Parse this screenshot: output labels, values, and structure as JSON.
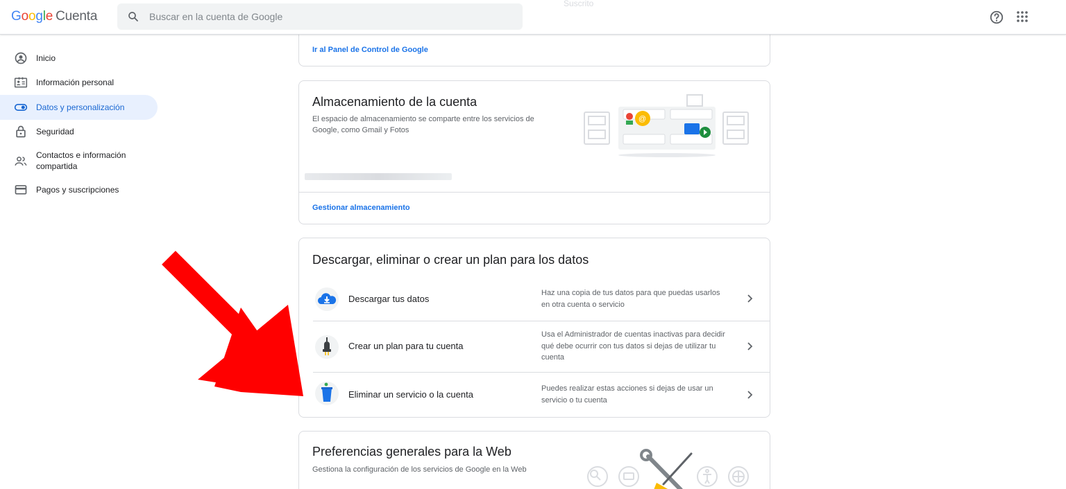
{
  "header": {
    "logo_text": "Google",
    "product": "Cuenta",
    "search_placeholder": "Buscar en la cuenta de Google",
    "ghost_text": "Suscrito",
    "help_icon": "help-icon",
    "apps_icon": "apps-grid-icon"
  },
  "sidebar": {
    "items": [
      {
        "label": "Inicio",
        "icon": "account-circle-icon",
        "active": false
      },
      {
        "label": "Información personal",
        "icon": "id-card-icon",
        "active": false
      },
      {
        "label": "Datos y personalización",
        "icon": "toggle-icon",
        "active": true
      },
      {
        "label": "Seguridad",
        "icon": "lock-icon",
        "active": false
      },
      {
        "label": "Contactos e información compartida",
        "icon": "people-icon",
        "active": false
      },
      {
        "label": "Pagos y suscripciones",
        "icon": "credit-card-icon",
        "active": false
      }
    ]
  },
  "dashboard_card": {
    "link": "Ir al Panel de Control de Google"
  },
  "storage_card": {
    "title": "Almacenamiento de la cuenta",
    "description": "El espacio de almacenamiento se comparte entre los servicios de Google, como Gmail y Fotos",
    "link": "Gestionar almacenamiento"
  },
  "data_card": {
    "title": "Descargar, eliminar o crear un plan para los datos",
    "rows": [
      {
        "title": "Descargar tus datos",
        "description": "Haz una copia de tus datos para que puedas usarlos en otra cuenta o servicio",
        "icon": "cloud-download-icon"
      },
      {
        "title": "Crear un plan para tu cuenta",
        "description": "Usa el Administrador de cuentas inactivas para decidir qué debe ocurrir con tus datos si dejas de utilizar tu cuenta",
        "icon": "plug-icon"
      },
      {
        "title": "Eliminar un servicio o la cuenta",
        "description": "Puedes realizar estas acciones si dejas de usar un servicio o tu cuenta",
        "icon": "trash-bin-icon"
      }
    ]
  },
  "web_card": {
    "title": "Preferencias generales para la Web",
    "description": "Gestiona la configuración de los servicios de Google en la Web"
  },
  "colors": {
    "accent": "#1a73e8",
    "active_bg": "#e8f0fe",
    "annotation_arrow": "#ff0000"
  }
}
